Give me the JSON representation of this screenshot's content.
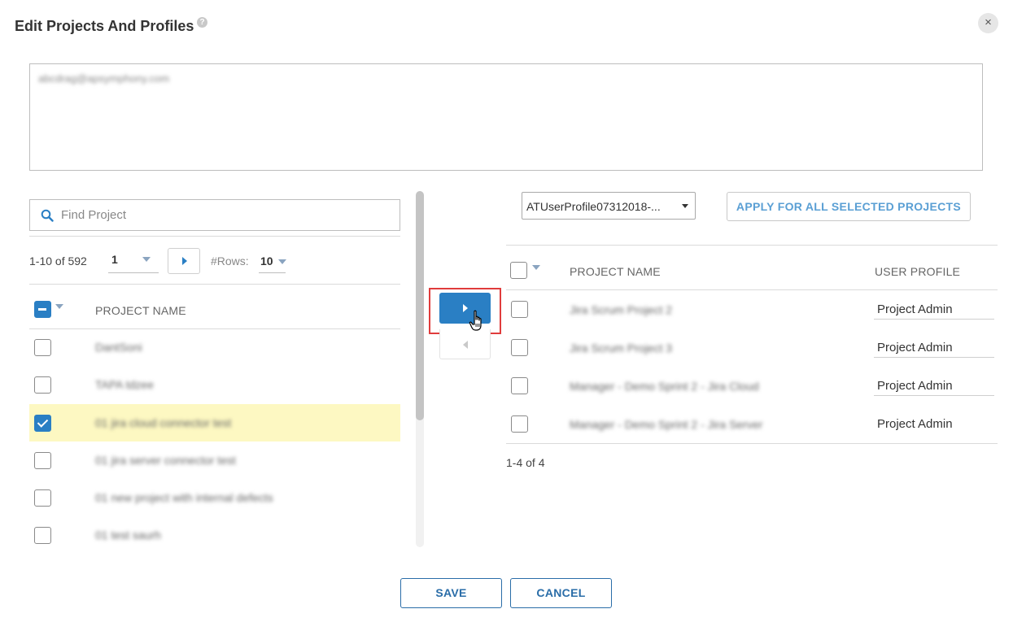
{
  "dialog": {
    "title": "Edit Projects And Profiles",
    "help_icon_glyph": "?",
    "close_glyph": "×"
  },
  "users": {
    "selected_user": "abcdrag@apsymphony.com"
  },
  "left_panel": {
    "search_placeholder": "Find Project",
    "count_text": "1-10 of 592",
    "page_value": "1",
    "rows_label": "#Rows:",
    "rows_value": "10",
    "column_header": "PROJECT NAME",
    "rows": [
      {
        "name": "DantSoni",
        "checked": false
      },
      {
        "name": "TAPA tdzee",
        "checked": false
      },
      {
        "name": "01 jira cloud connector test",
        "checked": true
      },
      {
        "name": "01 jira server connector test",
        "checked": false
      },
      {
        "name": "01 new project with internal defects",
        "checked": false
      },
      {
        "name": "01 test saurh",
        "checked": false
      }
    ]
  },
  "right_panel": {
    "profile_select_value": "ATUserProfile07312018-...",
    "apply_button": "APPLY FOR ALL SELECTED PROJECTS",
    "column_project": "PROJECT NAME",
    "column_profile": "USER PROFILE",
    "rows": [
      {
        "name": "Jira Scrum Project 2",
        "profile": "Project Admin"
      },
      {
        "name": "Jira Scrum Project 3",
        "profile": "Project Admin"
      },
      {
        "name": "Manager - Demo Sprint 2 - Jira Cloud",
        "profile": "Project Admin"
      },
      {
        "name": "Manager - Demo Sprint 2 - Jira Server",
        "profile": "Project Admin"
      }
    ],
    "count_text": "1-4 of 4"
  },
  "footer": {
    "save_label": "SAVE",
    "cancel_label": "CANCEL"
  },
  "colors": {
    "accent": "#2a7fc4",
    "highlight_row": "#fdf8c2",
    "annotation_box": "#e03c3c"
  },
  "icons": {
    "search": "search-icon",
    "next": "chevron-right-icon",
    "move_right": "arrow-right-icon",
    "move_left": "arrow-left-icon",
    "close": "close-icon",
    "help": "help-icon",
    "cursor": "hand-cursor-icon"
  }
}
